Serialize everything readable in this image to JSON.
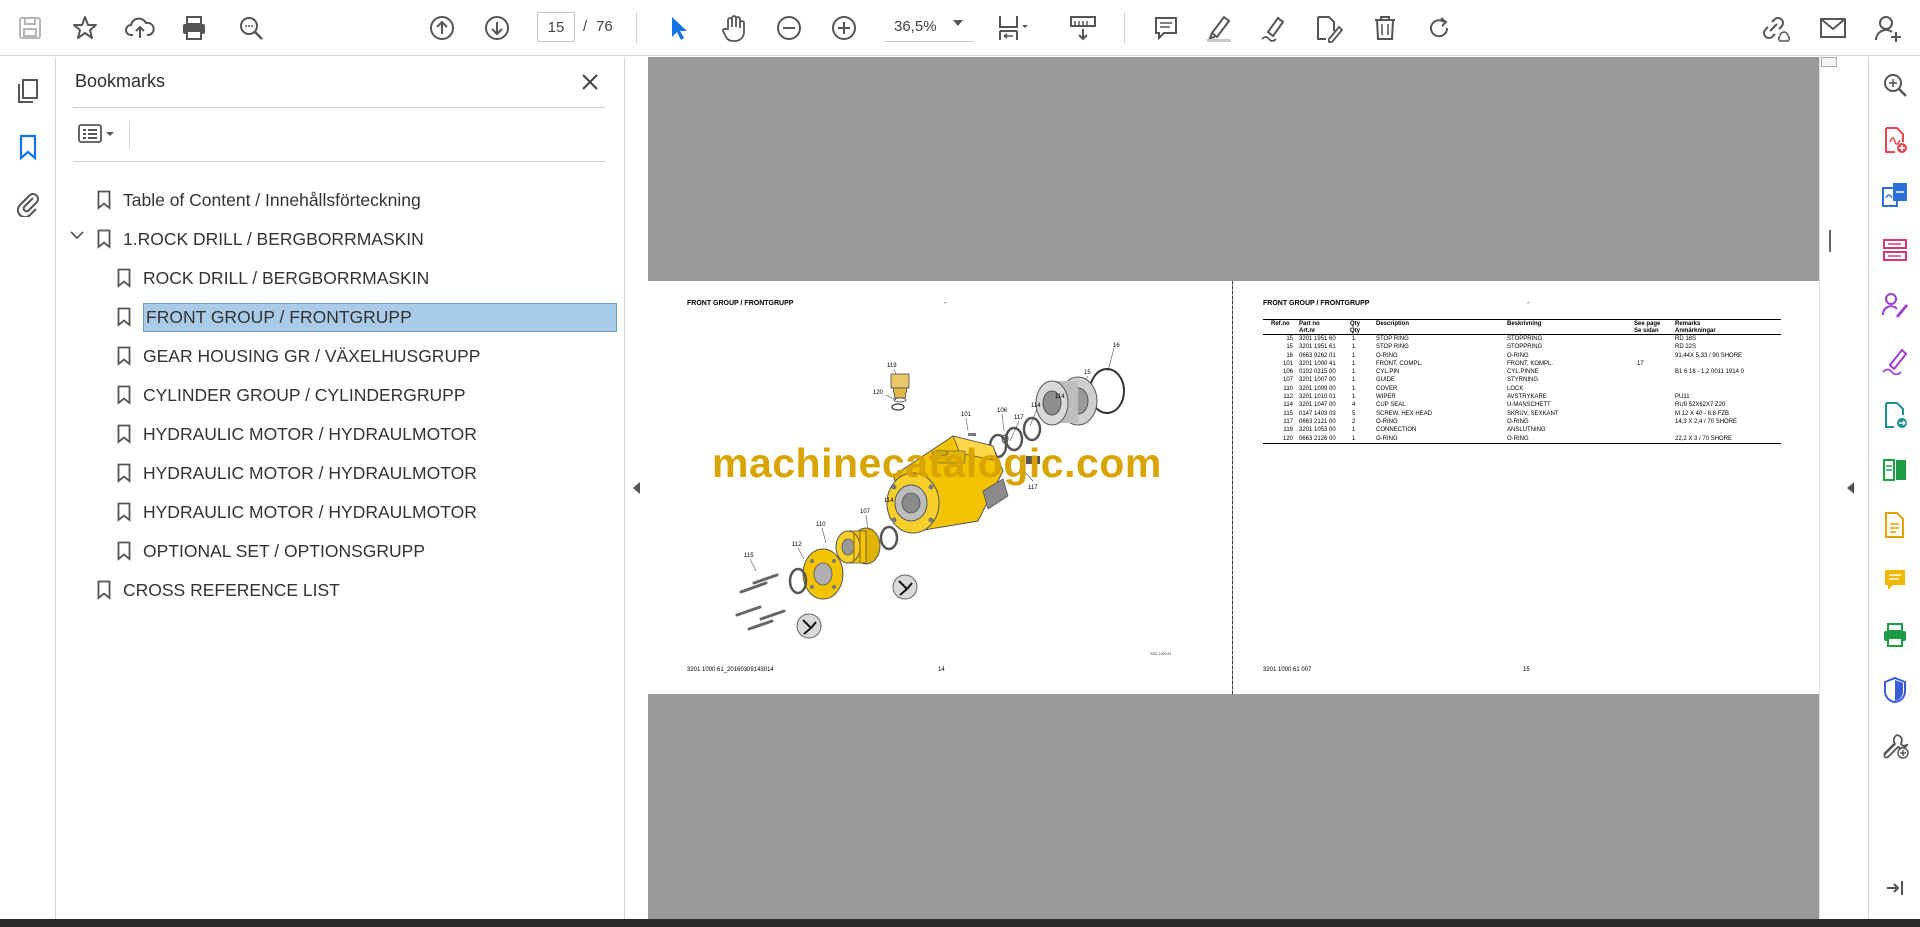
{
  "toolbar": {
    "page_current": "15",
    "page_separator": "/",
    "page_total": "76",
    "zoom": "36,5%"
  },
  "bookmarks": {
    "title": "Bookmarks",
    "items": [
      {
        "label": "Table of Content / Innehållsförteckning",
        "level": 0
      },
      {
        "label": "1.ROCK DRILL / BERGBORRMASKIN",
        "level": 0,
        "expanded": true
      },
      {
        "label": "ROCK DRILL / BERGBORRMASKIN",
        "level": 1
      },
      {
        "label": "FRONT GROUP / FRONTGRUPP",
        "level": 1,
        "selected": true
      },
      {
        "label": "GEAR HOUSING GR / VÄXELHUSGRUPP",
        "level": 1
      },
      {
        "label": "CYLINDER GROUP / CYLINDERGRUPP",
        "level": 1
      },
      {
        "label": "HYDRAULIC MOTOR / HYDRAULMOTOR",
        "level": 1
      },
      {
        "label": "HYDRAULIC MOTOR / HYDRAULMOTOR",
        "level": 1
      },
      {
        "label": "HYDRAULIC MOTOR / HYDRAULMOTOR",
        "level": 1
      },
      {
        "label": "OPTIONAL SET / OPTIONSGRUPP",
        "level": 1
      },
      {
        "label": "CROSS REFERENCE LIST",
        "level": 0
      }
    ]
  },
  "document": {
    "left_page": {
      "header": "FRONT GROUP / FRONTGRUPP",
      "dash": "-",
      "footer_left": "3201 1000 61_20160309143014",
      "footer_page": "14",
      "drawing_code": "3201 1000 61",
      "callouts": [
        "119",
        "16",
        "120",
        "15",
        "101",
        "106",
        "117",
        "114",
        "114",
        "117",
        "110",
        "107",
        "114",
        "112",
        "115"
      ]
    },
    "right_page": {
      "header": "FRONT GROUP / FRONTGRUPP",
      "dash": "-",
      "footer_left": "3201 1000 61 007",
      "footer_page": "15",
      "table_headers": [
        [
          "Ref.no",
          ""
        ],
        [
          "Part no",
          "Art.nr"
        ],
        [
          "Qty",
          "Qty"
        ],
        [
          "Description",
          ""
        ],
        [
          "Beskrivning",
          ""
        ],
        [
          "See page",
          "Se sidan"
        ],
        [
          "Remarks",
          "Anmärkningar"
        ]
      ],
      "rows": [
        [
          "15",
          "3201 1951 60",
          "1",
          "STOP RING",
          "STOPPRING",
          "",
          "RD 18S"
        ],
        [
          "15",
          "3201 1951 61",
          "1",
          "STOP RING",
          "STOPPRING",
          "",
          "RD 22S"
        ],
        [
          "16",
          "0663 9262 01",
          "1",
          "O-RING",
          "O-RING",
          "",
          "91,44X 5,33 / 90 SHORE"
        ],
        [
          "101",
          "3201 1000 41",
          "1",
          "FRONT, COMPL.",
          "FRONT, KOMPL.",
          "17",
          ""
        ],
        [
          "106",
          "0102 0315 00",
          "1",
          "CYL.PIN",
          "CYL.PINNE",
          "",
          "B1 6 16 - 1,2 0011 1914 0"
        ],
        [
          "107",
          "3201 1007 00",
          "1",
          "GUIDE",
          "STYRNING",
          "",
          ""
        ],
        [
          "110",
          "3201 1009 00",
          "1",
          "COVER",
          "LOCK",
          "",
          ""
        ],
        [
          "112",
          "3201 1010 01",
          "1",
          "WIPER",
          "AVSTRYKARE",
          "",
          "PU11"
        ],
        [
          "114",
          "3201 1047 00",
          "4",
          "CUP SEAL",
          "U-MANSCHETT",
          "",
          "RU9 52X62X7 Z20"
        ],
        [
          "115",
          "0147 1403 03",
          "5",
          "SCREW, HEX HEAD",
          "SKRUV, SEXKANT",
          "",
          "M 12 X 40 - 8.8 FZB"
        ],
        [
          "117",
          "0663 2121 00",
          "2",
          "O-RING",
          "O-RING",
          "",
          "14,3 X 2,4 / 70 SHORE"
        ],
        [
          "119",
          "3201 1053 00",
          "1",
          "CONNECTION",
          "ANSLUTNING",
          "",
          ""
        ],
        [
          "120",
          "0663 2126 00",
          "1",
          "O-RING",
          "O-RING",
          "",
          "22,2 X 3 / 70 SHORE"
        ]
      ]
    },
    "watermark": "machinecatalogic.com"
  },
  "colors": {
    "accent_blue": "#1473e6",
    "selection": "#a9cbe8",
    "viewport_gray": "#999999",
    "part_yellow": "#f2c300",
    "watermark": "#d8a400"
  }
}
